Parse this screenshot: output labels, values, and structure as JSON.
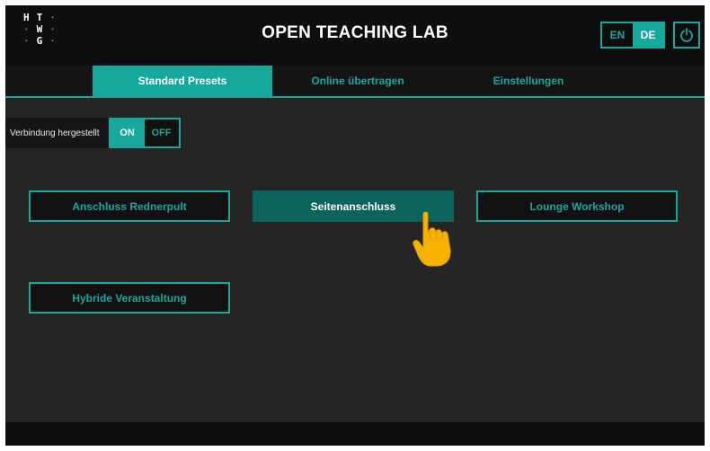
{
  "header": {
    "logo_letters": [
      [
        "H",
        "T",
        "·"
      ],
      [
        "·",
        "W",
        "·"
      ],
      [
        "·",
        "G",
        "·"
      ]
    ],
    "title": "OPEN TEACHING LAB",
    "languages": [
      {
        "label": "EN",
        "active": false
      },
      {
        "label": "DE",
        "active": true
      }
    ]
  },
  "tabs": [
    {
      "label": "Standard Presets",
      "active": true
    },
    {
      "label": "Online übertragen",
      "active": false
    },
    {
      "label": "Einstellungen",
      "active": false
    }
  ],
  "connection": {
    "label": "Verbindung hergestellt",
    "on": "ON",
    "off": "OFF"
  },
  "presets": [
    {
      "label": "Anschluss Rednerpult",
      "selected": false
    },
    {
      "label": "Seitenanschluss",
      "selected": true
    },
    {
      "label": "Lounge Workshop",
      "selected": false
    },
    {
      "label": "Hybride Veranstaltung",
      "selected": false
    }
  ],
  "colors": {
    "accent": "#17a89d",
    "selected": "#0c635c",
    "background": "#252525",
    "cursor": "#f7b200"
  },
  "icons": {
    "power": "power-icon",
    "pointer": "hand-pointer-icon"
  }
}
